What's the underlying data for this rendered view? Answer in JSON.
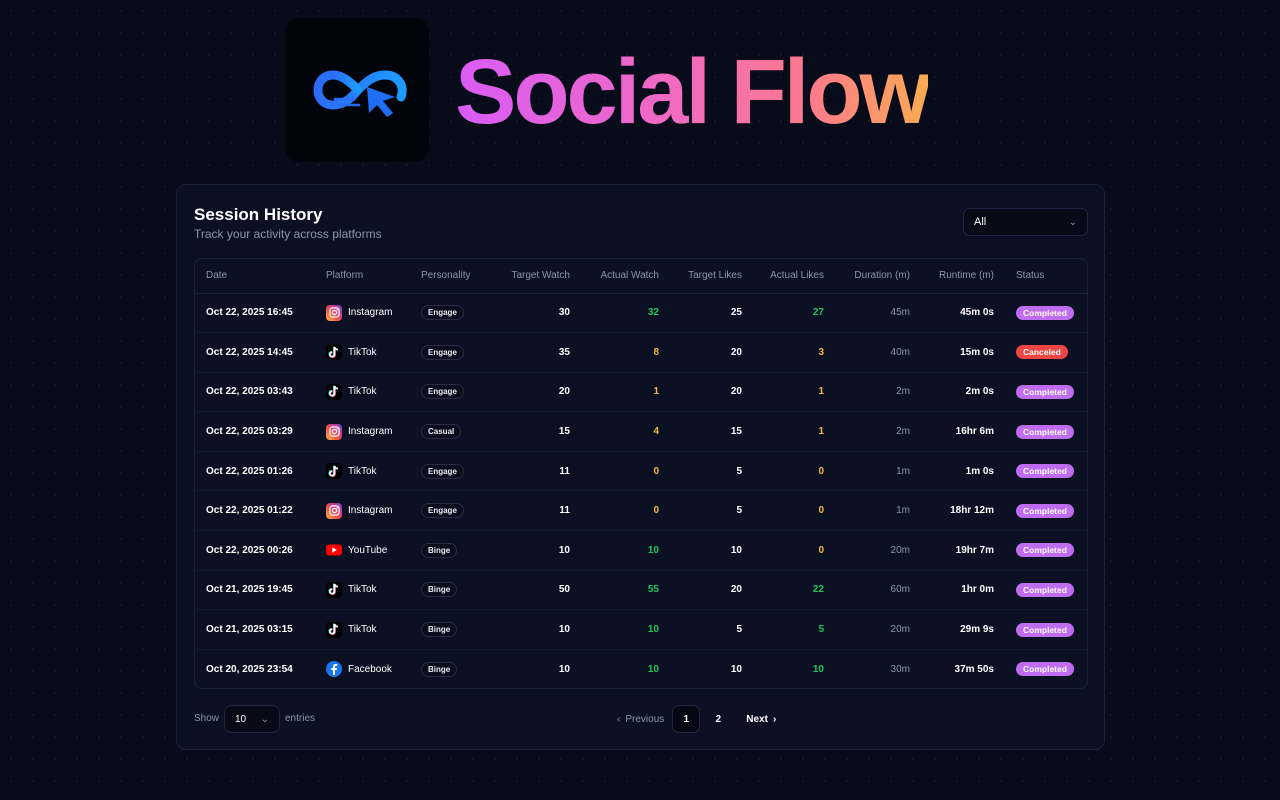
{
  "brand": {
    "name": "Social Flow"
  },
  "card": {
    "title": "Session History",
    "subtitle": "Track your activity across platforms",
    "filter_value": "All"
  },
  "table": {
    "headers": [
      "Date",
      "Platform",
      "Personality",
      "Target Watch",
      "Actual Watch",
      "Target Likes",
      "Actual Likes",
      "Duration (m)",
      "Runtime (m)",
      "Status"
    ],
    "rows": [
      {
        "date": "Oct 22, 2025 16:45",
        "platform": "Instagram",
        "personality": "Engage",
        "target_watch": "30",
        "actual_watch": "32",
        "target_likes": "25",
        "actual_likes": "27",
        "duration": "45m",
        "runtime": "45m 0s",
        "status": "Completed"
      },
      {
        "date": "Oct 22, 2025 14:45",
        "platform": "TikTok",
        "personality": "Engage",
        "target_watch": "35",
        "actual_watch": "8",
        "target_likes": "20",
        "actual_likes": "3",
        "duration": "40m",
        "runtime": "15m 0s",
        "status": "Canceled"
      },
      {
        "date": "Oct 22, 2025 03:43",
        "platform": "TikTok",
        "personality": "Engage",
        "target_watch": "20",
        "actual_watch": "1",
        "target_likes": "20",
        "actual_likes": "1",
        "duration": "2m",
        "runtime": "2m 0s",
        "status": "Completed"
      },
      {
        "date": "Oct 22, 2025 03:29",
        "platform": "Instagram",
        "personality": "Casual",
        "target_watch": "15",
        "actual_watch": "4",
        "target_likes": "15",
        "actual_likes": "1",
        "duration": "2m",
        "runtime": "16hr 6m",
        "status": "Completed"
      },
      {
        "date": "Oct 22, 2025 01:26",
        "platform": "TikTok",
        "personality": "Engage",
        "target_watch": "11",
        "actual_watch": "0",
        "target_likes": "5",
        "actual_likes": "0",
        "duration": "1m",
        "runtime": "1m 0s",
        "status": "Completed"
      },
      {
        "date": "Oct 22, 2025 01:22",
        "platform": "Instagram",
        "personality": "Engage",
        "target_watch": "11",
        "actual_watch": "0",
        "target_likes": "5",
        "actual_likes": "0",
        "duration": "1m",
        "runtime": "18hr 12m",
        "status": "Completed"
      },
      {
        "date": "Oct 22, 2025 00:26",
        "platform": "YouTube",
        "personality": "Binge",
        "target_watch": "10",
        "actual_watch": "10",
        "target_likes": "10",
        "actual_likes": "0",
        "duration": "20m",
        "runtime": "19hr 7m",
        "status": "Completed"
      },
      {
        "date": "Oct 21, 2025 19:45",
        "platform": "TikTok",
        "personality": "Binge",
        "target_watch": "50",
        "actual_watch": "55",
        "target_likes": "20",
        "actual_likes": "22",
        "duration": "60m",
        "runtime": "1hr 0m",
        "status": "Completed"
      },
      {
        "date": "Oct 21, 2025 03:15",
        "platform": "TikTok",
        "personality": "Binge",
        "target_watch": "10",
        "actual_watch": "10",
        "target_likes": "5",
        "actual_likes": "5",
        "duration": "20m",
        "runtime": "29m 9s",
        "status": "Completed"
      },
      {
        "date": "Oct 20, 2025 23:54",
        "platform": "Facebook",
        "personality": "Binge",
        "target_watch": "10",
        "actual_watch": "10",
        "target_likes": "10",
        "actual_likes": "10",
        "duration": "30m",
        "runtime": "37m 50s",
        "status": "Completed"
      }
    ]
  },
  "footer": {
    "show_label": "Show",
    "page_size": "10",
    "entries_label": "entries",
    "prev_label": "Previous",
    "pages": [
      "1",
      "2"
    ],
    "current_page": "1",
    "next_label": "Next"
  },
  "colors": {
    "background": "#070b1a",
    "card": "#0b1022",
    "good_value": "#22c55e",
    "warn_value": "#f5b942",
    "completed_badge": "#c06cf0",
    "canceled_badge": "#ef4444"
  }
}
